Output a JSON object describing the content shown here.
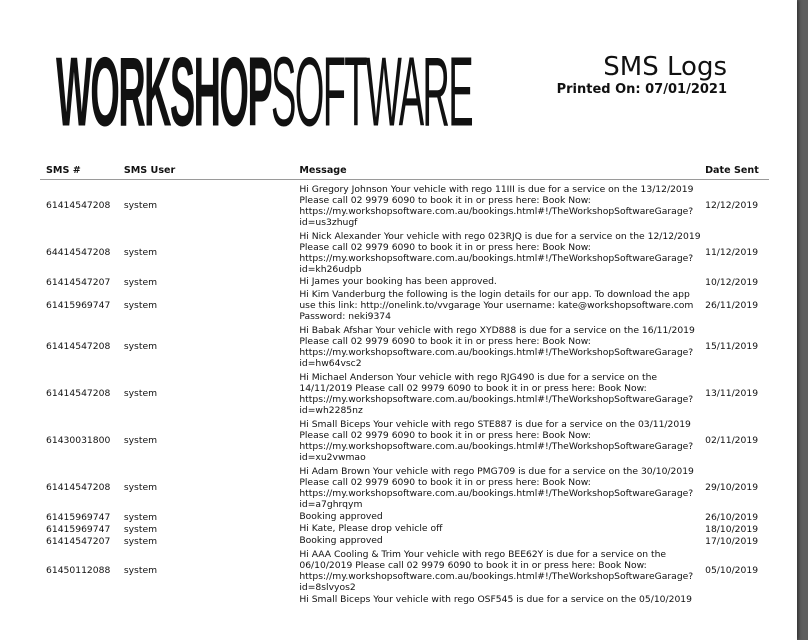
{
  "header": {
    "logo_bold": "WORKSHOP",
    "logo_light": "SOFTWARE",
    "title": "SMS Logs",
    "printed_on": "Printed On: 07/01/2021"
  },
  "table": {
    "columns": [
      "SMS #",
      "SMS User",
      "Message",
      "Date Sent"
    ],
    "rows": [
      {
        "number": "61414547208",
        "user": "system",
        "message": "Hi Gregory Johnson Your vehicle with rego 11III is due for a service on the 13/12/2019 Please call 02 9979 6090 to book it in or press here: Book Now: https://my.workshopsoftware.com.au/bookings.html#!/TheWorkshopSoftwareGarage?id=us3zhugf",
        "date": "12/12/2019"
      },
      {
        "number": "64414547208",
        "user": "system",
        "message": "Hi Nick Alexander Your vehicle with rego 023RJQ is due for a service on the 12/12/2019 Please call 02 9979 6090 to book it in or press here: Book Now: https://my.workshopsoftware.com.au/bookings.html#!/TheWorkshopSoftwareGarage?id=kh26udpb",
        "date": "11/12/2019"
      },
      {
        "number": "61414547207",
        "user": "system",
        "message": "Hi James your booking has been approved.",
        "date": "10/12/2019"
      },
      {
        "number": "61415969747",
        "user": "system",
        "message": "Hi Kim Vanderburg the following is the login details for our app. To download the app use this link: http://onelink.to/vvgarage Your username: kate@workshopsoftware.com Password: neki9374",
        "date": "26/11/2019"
      },
      {
        "number": "61414547208",
        "user": "system",
        "message": "Hi Babak Afshar Your vehicle with rego XYD888 is due for a service on the 16/11/2019 Please call 02 9979 6090 to book it in or press here: Book Now: https://my.workshopsoftware.com.au/bookings.html#!/TheWorkshopSoftwareGarage?id=hw64vsc2",
        "date": "15/11/2019"
      },
      {
        "number": "61414547208",
        "user": "system",
        "message": "Hi Michael Anderson Your vehicle with rego RJG490 is due for a service on the 14/11/2019 Please call 02 9979 6090 to book it in or press here: Book Now: https://my.workshopsoftware.com.au/bookings.html#!/TheWorkshopSoftwareGarage?id=wh2285nz",
        "date": "13/11/2019"
      },
      {
        "number": "61430031800",
        "user": "system",
        "message": "Hi Small Biceps Your vehicle with rego STE887 is due for a service on the 03/11/2019 Please call 02 9979 6090 to book it in or press here: Book Now: https://my.workshopsoftware.com.au/bookings.html#!/TheWorkshopSoftwareGarage?id=xu2vwmao",
        "date": "02/11/2019"
      },
      {
        "number": "61414547208",
        "user": "system",
        "message": "Hi Adam Brown Your vehicle with rego PMG709 is due for a service on the 30/10/2019 Please call 02 9979 6090 to book it in or press here: Book Now: https://my.workshopsoftware.com.au/bookings.html#!/TheWorkshopSoftwareGarage?id=a7ghrqym",
        "date": "29/10/2019"
      },
      {
        "number": "61415969747",
        "user": "system",
        "message": "Booking approved",
        "date": "26/10/2019"
      },
      {
        "number": "61415969747",
        "user": "system",
        "message": "Hi Kate, Please drop vehicle off",
        "date": "18/10/2019"
      },
      {
        "number": "61414547207",
        "user": "system",
        "message": "Booking approved",
        "date": "17/10/2019"
      },
      {
        "number": "61450112088",
        "user": "system",
        "message": "Hi AAA Cooling & Trim Your vehicle with rego BEE62Y is due for a service on the 06/10/2019 Please call 02 9979 6090 to book it in or press here: Book Now: https://my.workshopsoftware.com.au/bookings.html#!/TheWorkshopSoftwareGarage?id=8slvyos2",
        "date": "05/10/2019"
      },
      {
        "number": "",
        "user": "",
        "message": "Hi Small Biceps Your vehicle with rego OSF545 is due for a service on the 05/10/2019",
        "date": ""
      }
    ]
  }
}
